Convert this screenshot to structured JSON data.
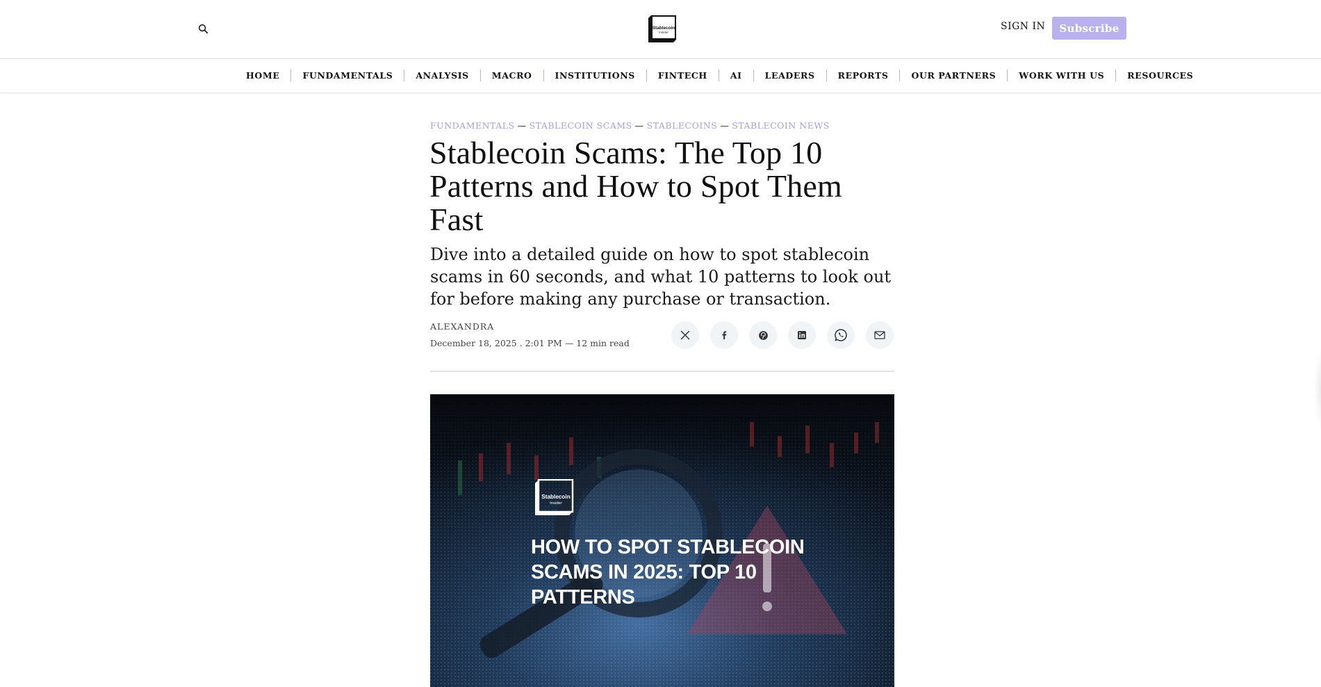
{
  "header": {
    "logo_text": "Stablecoin Insider",
    "sign_in_label": "SIGN IN",
    "subscribe_label": "Subscribe"
  },
  "nav": {
    "items": [
      {
        "label": "HOME"
      },
      {
        "label": "FUNDAMENTALS"
      },
      {
        "label": "ANALYSIS"
      },
      {
        "label": "MACRO"
      },
      {
        "label": "INSTITUTIONS"
      },
      {
        "label": "FINTECH"
      },
      {
        "label": "AI"
      },
      {
        "label": "LEADERS"
      },
      {
        "label": "REPORTS"
      },
      {
        "label": "OUR PARTNERS"
      },
      {
        "label": "WORK WITH US"
      },
      {
        "label": "RESOURCES"
      }
    ]
  },
  "article": {
    "categories": [
      "FUNDAMENTALS",
      "STABLECOIN SCAMS",
      "STABLECOINS",
      "STABLECOIN NEWS"
    ],
    "category_separator": "—",
    "title": "Stablecoin Scams: The Top 10 Patterns and How to Spot Them Fast",
    "subtitle": "Dive into a detailed guide on how to spot stablecoin scams in 60 seconds, and what 10 patterns to look out for before making any purchase or transaction.",
    "author": "ALEXANDRA",
    "meta": "December 18, 2025 . 2:01 PM — 12 min read",
    "share_icons": [
      "x-icon",
      "facebook-icon",
      "pinterest-icon",
      "linkedin-icon",
      "whatsapp-icon",
      "email-icon"
    ],
    "hero": {
      "logo_text": "Stablecoin Insider",
      "headline": "HOW TO SPOT STABLECOIN SCAMS IN 2025: TOP 10 PATTERNS"
    }
  },
  "colors": {
    "accent": "#b9b0ee",
    "category": "#a79fe6",
    "nav_separator": "#b8b0ea",
    "share_bg": "#f1f4f6"
  }
}
